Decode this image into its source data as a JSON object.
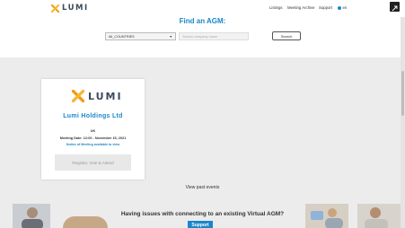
{
  "header": {
    "brand": "LUMI",
    "nav": {
      "listings": "Listings",
      "meeting_archive": "Meeting Archive",
      "support": "Support",
      "language": "en"
    }
  },
  "search": {
    "title": "Find an AGM:",
    "select_value": "All_COUNTRIES",
    "input_placeholder": "Search company name",
    "button_label": "Search"
  },
  "meeting_card": {
    "brand": "LUMI",
    "company": "Lumi Holdings Ltd",
    "country": "UK",
    "meeting_date": "Meeting Date: 12:00 - November 15, 2021",
    "notice": "Notice of Meeting available to view",
    "register_button": "Register, Vote & Attend"
  },
  "past_events_link": "View past events",
  "footer": {
    "question": "Having issues with connecting to an existing Virtual AGM?",
    "support_button": "Support"
  },
  "colors": {
    "accent": "#1b86c9",
    "logo_orange": "#f39c12",
    "background": "#ececec"
  }
}
